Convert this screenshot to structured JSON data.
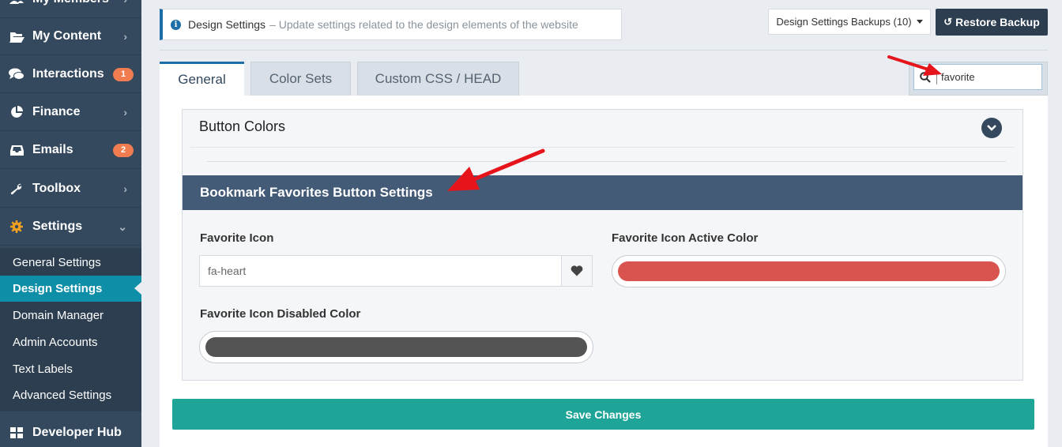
{
  "sidebar": {
    "items": [
      {
        "label": "My Members",
        "icon": "users-icon",
        "chevron": true
      },
      {
        "label": "My Content",
        "icon": "folder-open-icon",
        "chevron": true
      },
      {
        "label": "Interactions",
        "icon": "comments-icon",
        "badge": "1"
      },
      {
        "label": "Finance",
        "icon": "pie-chart-icon",
        "chevron": true
      },
      {
        "label": "Emails",
        "icon": "inbox-icon",
        "badge": "2"
      },
      {
        "label": "Toolbox",
        "icon": "wrench-icon",
        "chevron": true
      },
      {
        "label": "Settings",
        "icon": "gear-icon",
        "chevron_down": true
      }
    ],
    "submenu": [
      {
        "label": "General Settings"
      },
      {
        "label": "Design Settings",
        "active": true
      },
      {
        "label": "Domain Manager"
      },
      {
        "label": "Admin Accounts"
      },
      {
        "label": "Text Labels"
      },
      {
        "label": "Advanced Settings"
      }
    ],
    "developer_hub": {
      "label": "Developer Hub",
      "icon": "grid-icon"
    }
  },
  "header": {
    "title": "Design Settings",
    "description": "– Update settings related to the design elements of the website",
    "backups_label": "Design Settings Backups (10)",
    "restore_label": "Restore Backup"
  },
  "tabs": [
    {
      "label": "General",
      "active": true
    },
    {
      "label": "Color Sets"
    },
    {
      "label": "Custom CSS / HEAD"
    }
  ],
  "search": {
    "value": "favorite"
  },
  "section": {
    "title": "Button Colors",
    "subsection_title": "Bookmark Favorites Button Settings",
    "fields": {
      "favorite_icon_label": "Favorite Icon",
      "favorite_icon_value": "fa-heart",
      "active_color_label": "Favorite Icon Active Color",
      "active_color": "#d9534f",
      "disabled_color_label": "Favorite Icon Disabled Color",
      "disabled_color": "#545454"
    }
  },
  "save_label": "Save Changes",
  "colors": {
    "sidebar_bg": "#34495e",
    "active_item": "#0e8fa7",
    "save_button": "#1fa597",
    "subheader": "#435b77",
    "badge": "#f07c50",
    "annotation_arrow": "#e5151b"
  }
}
